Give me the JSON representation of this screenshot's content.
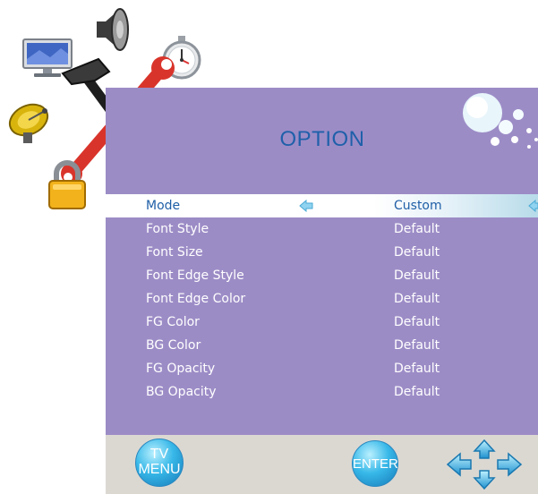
{
  "title": "OPTION",
  "menu": [
    {
      "label": "Mode",
      "value": "Custom",
      "selected": true
    },
    {
      "label": "Font Style",
      "value": "Default",
      "selected": false
    },
    {
      "label": "Font Size",
      "value": "Default",
      "selected": false
    },
    {
      "label": "Font Edge Style",
      "value": "Default",
      "selected": false
    },
    {
      "label": "Font Edge Color",
      "value": "Default",
      "selected": false
    },
    {
      "label": "FG Color",
      "value": "Default",
      "selected": false
    },
    {
      "label": "BG Color",
      "value": "Default",
      "selected": false
    },
    {
      "label": "FG Opacity",
      "value": "Default",
      "selected": false
    },
    {
      "label": "BG Opacity",
      "value": "Default",
      "selected": false
    }
  ],
  "footer": {
    "menu_button": {
      "line1": "TV",
      "line2": "MENU"
    },
    "enter_button": "ENTER"
  },
  "icons": [
    "monitor-icon",
    "speaker-icon",
    "stopwatch-icon",
    "satellite-dish-icon",
    "tools-icon",
    "lock-icon",
    "bubbles-decoration",
    "arrow-left-icon",
    "arrow-right-icon",
    "dpad-icon"
  ],
  "colors": {
    "panel": "#9c8cc6",
    "title": "#1f60aa",
    "footer": "#dbd8d2",
    "button": "#37b8e8"
  }
}
